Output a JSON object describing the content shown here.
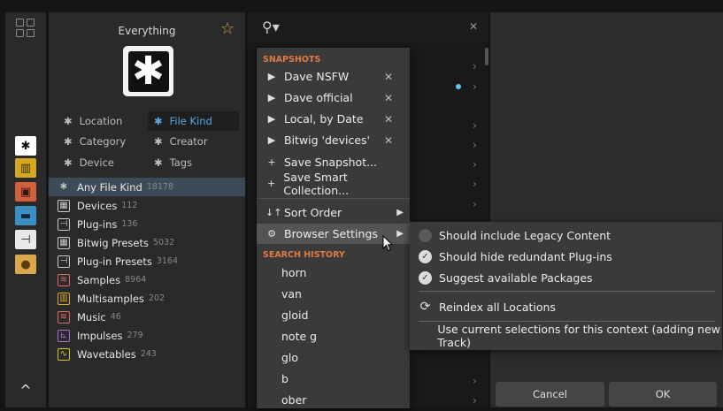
{
  "colors": {
    "accent_blue": "#5aa9e6",
    "section_orange": "#e07a44",
    "star": "#c9a44a",
    "selected_row": "#3d4a57"
  },
  "rail": {
    "buttons": [
      {
        "name": "all-kinds",
        "icon": "asterisk-icon",
        "glyph": "✱",
        "bg": "#ffffff",
        "fg": "#111111"
      },
      {
        "name": "instruments",
        "icon": "piano-icon",
        "glyph": "▥",
        "bg": "#d4a820",
        "fg": "#3a2c00"
      },
      {
        "name": "audio-fx",
        "icon": "pedal-icon",
        "glyph": "▣",
        "bg": "#d0603e",
        "fg": "#3a1408"
      },
      {
        "name": "note-fx",
        "icon": "note-fx-icon",
        "glyph": "▬",
        "bg": "#3c8ec4",
        "fg": "#0d2a3d"
      },
      {
        "name": "plugins",
        "icon": "plug-icon",
        "glyph": "⊣",
        "bg": "#e8e8e8",
        "fg": "#222222"
      },
      {
        "name": "user",
        "icon": "person-icon",
        "glyph": "●",
        "bg": "#d8a84a",
        "fg": "#5a3d08"
      }
    ]
  },
  "panel": {
    "title": "Everything",
    "filters": {
      "location": "Location",
      "file_kind": "File Kind",
      "category": "Category",
      "creator": "Creator",
      "device": "Device",
      "tags": "Tags"
    },
    "items": [
      {
        "label": "Any File Kind",
        "count": "18178",
        "icon": "asterisk-icon",
        "glyph": "✱",
        "color": "#cccccc"
      },
      {
        "label": "Devices",
        "count": "112",
        "icon": "device-icon",
        "glyph": "▦",
        "color": "#cccccc"
      },
      {
        "label": "Plug-ins",
        "count": "136",
        "icon": "plug-icon",
        "glyph": "⊣",
        "color": "#cccccc"
      },
      {
        "label": "Bitwig Presets",
        "count": "5032",
        "icon": "preset-icon",
        "glyph": "▦",
        "color": "#cccccc"
      },
      {
        "label": "Plug-in Presets",
        "count": "3164",
        "icon": "plugin-preset-icon",
        "glyph": "⊣",
        "color": "#cccccc"
      },
      {
        "label": "Samples",
        "count": "8964",
        "icon": "waveform-icon",
        "glyph": "≋",
        "color": "#e06a6a"
      },
      {
        "label": "Multisamples",
        "count": "202",
        "icon": "keys-icon",
        "glyph": "▥",
        "color": "#d4a820"
      },
      {
        "label": "Music",
        "count": "46",
        "icon": "music-wave-icon",
        "glyph": "≋",
        "color": "#e06a6a"
      },
      {
        "label": "Impulses",
        "count": "279",
        "icon": "impulse-icon",
        "glyph": "⊾",
        "color": "#a870d8"
      },
      {
        "label": "Wavetables",
        "count": "243",
        "icon": "wavetable-icon",
        "glyph": "∿",
        "color": "#d4c820"
      }
    ]
  },
  "menu": {
    "snapshots_header": "SNAPSHOTS",
    "snapshots": [
      "Dave NSFW",
      "Dave official",
      "Local, by Date",
      "Bitwig 'devices'"
    ],
    "save_snapshot": "Save Snapshot...",
    "save_smart": "Save Smart Collection...",
    "sort_order": "Sort Order",
    "browser_settings": "Browser Settings",
    "history_header": "SEARCH HISTORY",
    "history": [
      "horn",
      "van",
      "gloid",
      "note g",
      "glo",
      "b",
      "ober"
    ]
  },
  "submenu": {
    "legacy": "Should include Legacy Content",
    "hide_redundant": "Should hide redundant Plug-ins",
    "suggest": "Suggest available Packages",
    "reindex": "Reindex all Locations",
    "use_current": "Use current selections for this context (adding new Track)"
  },
  "footer": {
    "cancel": "Cancel",
    "ok": "OK"
  }
}
